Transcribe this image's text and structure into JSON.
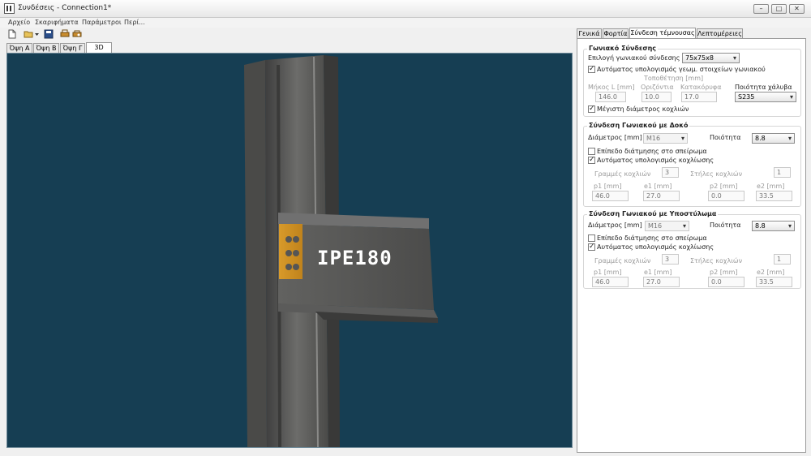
{
  "window": {
    "title": "Συνδέσεις - Connection1*",
    "min": "–",
    "max": "□",
    "close": "✕"
  },
  "menu": [
    "Αρχείο",
    "Σκαριφήματα",
    "Παράμετροι",
    "Περί..."
  ],
  "view_tabs": [
    "Όψη A",
    "Όψη B",
    "Όψη Γ",
    "3D"
  ],
  "viewport": {
    "beam_label": "IPE180",
    "bg": "#163e53"
  },
  "right_tabs": [
    "Γενικά",
    "Φορτία",
    "Σύνδεση τέμνουσας",
    "Λεπτομέρειες"
  ],
  "angle": {
    "title": "Γωνιακό Σύνδεσης",
    "select_label": "Επιλογή γωνιακού σύνδεσης",
    "select_value": "75x75x8",
    "auto_label": "Αυτόματος υπολογισμός γεωμ. στοιχείων γωνιακού",
    "auto_checked": true,
    "placement_label": "Τοποθέτηση [mm]",
    "length_label": "Μήκος L [mm]",
    "length_value": "146.0",
    "horiz_label": "Οριζόντια",
    "horiz_value": "10.0",
    "vert_label": "Κατακόρυφα",
    "vert_value": "17.0",
    "steel_label": "Ποιότητα χάλυβα",
    "steel_value": "S235",
    "maxbolt_label": "Μέγιστη διάμετρος κοχλιών",
    "maxbolt_checked": true
  },
  "beam_conn": {
    "title": "Σύνδεση Γωνιακού με Δοκό",
    "diam_label": "Διάμετρος [mm]",
    "diam_value": "M16",
    "quality_label": "Ποιότητα",
    "quality_value": "8.8",
    "shear_label": "Επίπεδο διάτμησης στο σπείρωμα",
    "shear_checked": false,
    "auto_label": "Αυτόματος υπολογισμός κοχλίωσης",
    "auto_checked": true,
    "rows_label": "Γραμμές κοχλιών",
    "rows_value": "3",
    "cols_label": "Στήλες κοχλιών",
    "cols_value": "1",
    "p1_label": "p1 [mm]",
    "p1_value": "46.0",
    "e1_label": "e1 [mm]",
    "e1_value": "27.0",
    "p2_label": "p2 [mm]",
    "p2_value": "0.0",
    "e2_label": "e2 [mm]",
    "e2_value": "33.5"
  },
  "col_conn": {
    "title": "Σύνδεση Γωνιακού με Υποστύλωμα",
    "diam_label": "Διάμετρος [mm]",
    "diam_value": "M16",
    "quality_label": "Ποιότητα",
    "quality_value": "8.8",
    "shear_label": "Επίπεδο διάτμησης στο σπείρωμα",
    "shear_checked": false,
    "auto_label": "Αυτόματος υπολογισμός κοχλίωσης",
    "auto_checked": true,
    "rows_label": "Γραμμές κοχλιών",
    "rows_value": "3",
    "cols_label": "Στήλες κοχλιών",
    "cols_value": "1",
    "p1_label": "p1 [mm]",
    "p1_value": "46.0",
    "e1_label": "e1 [mm]",
    "e1_value": "27.0",
    "p2_label": "p2 [mm]",
    "p2_value": "0.0",
    "e2_label": "e2 [mm]",
    "e2_value": "33.5"
  }
}
